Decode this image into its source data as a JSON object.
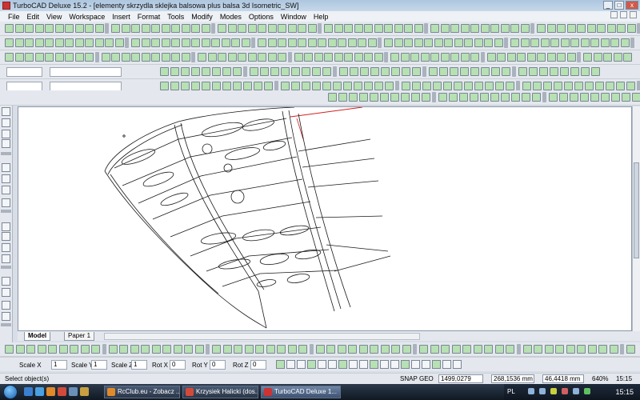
{
  "window": {
    "title": "TurboCAD Deluxe 15.2 - [elementy skrzydla sklejka balsowa plus balsa 3d Isometric_SW]",
    "controls": [
      "_",
      "□",
      "x"
    ]
  },
  "menu": [
    "File",
    "Edit",
    "View",
    "Workspace",
    "Insert",
    "Format",
    "Tools",
    "Modify",
    "Modes",
    "Options",
    "Window",
    "Help"
  ],
  "tabs": [
    {
      "label": "Model",
      "active": true
    },
    {
      "label": "Paper 1",
      "active": false
    }
  ],
  "inspector": {
    "fields": [
      {
        "label": "Scale X",
        "value": "1"
      },
      {
        "label": "Scale Y",
        "value": "1"
      },
      {
        "label": "Scale Z",
        "value": "1"
      },
      {
        "label": "Rot X",
        "value": "0"
      },
      {
        "label": "Rot Y",
        "value": "0"
      },
      {
        "label": "Rot Z",
        "value": "0"
      }
    ]
  },
  "status": {
    "prompt": "Select object(s)",
    "snap": "SNAP",
    "geo": "GEO",
    "x": "1499,0279 mm",
    "y": "268,1536 mm",
    "z": "46,4418 mm",
    "zoom": "640%",
    "time": "15:15"
  },
  "taskbar": {
    "tasks": [
      {
        "label": "RcClub.eu - Zobacz ...",
        "active": false
      },
      {
        "label": "Krzysiek Halicki (dos...",
        "active": false
      },
      {
        "label": "TurboCAD Deluxe 1...",
        "active": true
      }
    ],
    "lang": "PL",
    "clock": "15:15"
  },
  "colors": {
    "accent": "#2c3a4c",
    "drawing_line": "#1a1a1a",
    "red_line": "#d02020"
  }
}
